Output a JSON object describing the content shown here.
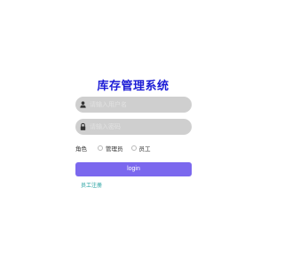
{
  "app": {
    "title": "库存管理系统"
  },
  "login_form": {
    "username": {
      "icon": "user-icon",
      "value": "",
      "placeholder": "请输入用户名"
    },
    "password": {
      "icon": "lock-icon",
      "value": "",
      "placeholder": "请输入密码"
    },
    "role": {
      "label": "角色",
      "options": [
        "管理员",
        "员工"
      ],
      "selected": ""
    },
    "login_label": "login",
    "register_link": "员工注册"
  },
  "colors": {
    "title": "#1b1bd6",
    "field_bg": "#cfcfcf",
    "button_bg": "#7b68ee",
    "link": "#1a9c9c"
  }
}
